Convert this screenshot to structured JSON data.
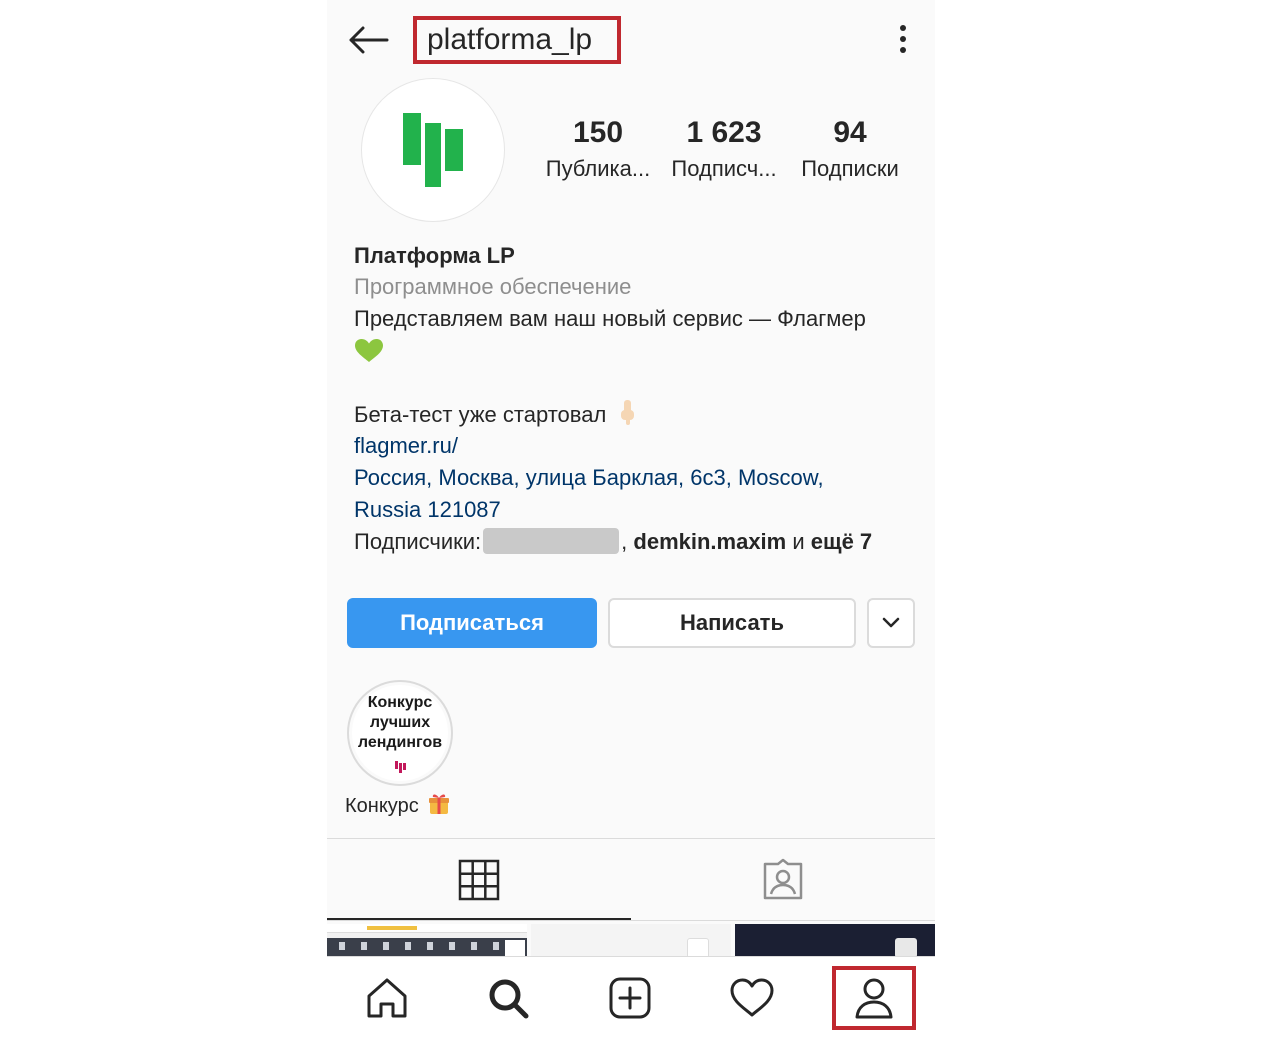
{
  "header": {
    "username": "platforma_lp",
    "back_icon": "back-arrow-icon",
    "menu_icon": "more-vertical-icon"
  },
  "profile": {
    "avatar_icon": "lp-logo-icon",
    "brand_color": "#22b24c"
  },
  "stats": [
    {
      "value": "150",
      "label": "Публика..."
    },
    {
      "value": "1 623",
      "label": "Подписч..."
    },
    {
      "value": "94",
      "label": "Подписки"
    }
  ],
  "bio": {
    "name": "Платформа LP",
    "category": "Программное обеспечение",
    "line1": "Представляем вам наш новый сервис — Флагмер",
    "line2": "Бета-тест уже стартовал",
    "link": "flagmer.ru/",
    "address_line1": "Россия, Москва, улица Барклая, 6с3, Moscow,",
    "address_line2": "Russia 121087",
    "followers_prefix": "Подписчики:",
    "followers_sep": ",",
    "followers_name": "demkin.maxim",
    "followers_and": "и",
    "followers_more": "ещё 7",
    "link_color": "#003569"
  },
  "buttons": {
    "follow": "Подписаться",
    "message": "Написать",
    "more_icon": "chevron-down-icon",
    "follow_color": "#3897f0"
  },
  "highlight": {
    "cover_line1": "Конкурс",
    "cover_line2": "лучших",
    "cover_line3": "лендингов",
    "label": "Конкурс",
    "label_icon": "gift-emoji-icon"
  },
  "tabs": [
    {
      "icon": "grid-icon",
      "active": true
    },
    {
      "icon": "tagged-person-icon",
      "active": false
    }
  ],
  "bottom_nav": [
    {
      "icon": "home-icon"
    },
    {
      "icon": "search-icon"
    },
    {
      "icon": "add-post-icon"
    },
    {
      "icon": "heart-icon"
    },
    {
      "icon": "profile-icon",
      "active": true
    }
  ],
  "annotation_color": "#c0282f"
}
